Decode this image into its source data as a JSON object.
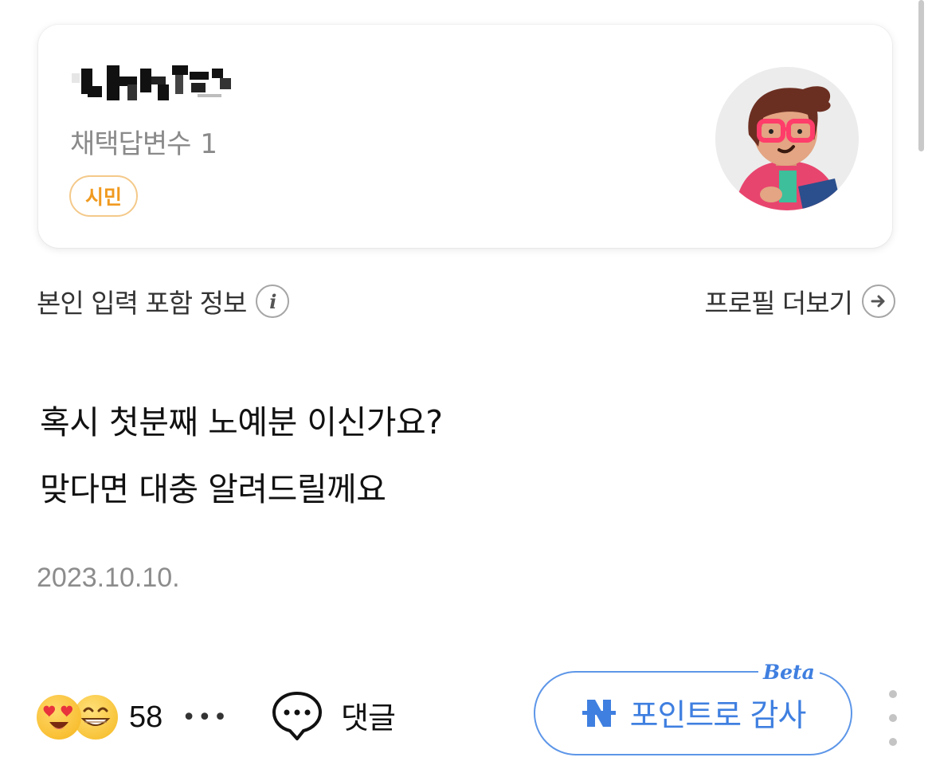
{
  "profile": {
    "answer_count_label": "채택답변수",
    "answer_count": "1",
    "grade": "시민"
  },
  "info": {
    "left_label": "본인 입력 포함 정보",
    "right_label": "프로필 더보기"
  },
  "answer": {
    "lines": [
      "혹시 첫분째 노예분 이신가요?",
      "맞다면 대충 알려드릴께요"
    ],
    "date": "2023.10.10."
  },
  "actions": {
    "reaction_count": "58",
    "more_reactions": "•••",
    "comment_label": "댓글",
    "thanks_label": "포인트로 감사",
    "beta_tag": "Beta"
  },
  "icons": {
    "info": "info-icon",
    "profile_more": "arrow-right-circle-icon",
    "comment": "speech-bubble-icon",
    "naver_pay": "naver-n-icon",
    "reaction_1": "heart-eyes-emoji",
    "reaction_2": "grinning-emoji",
    "menu": "vertical-dots-icon"
  },
  "colors": {
    "grade_badge": "#f09a20",
    "thanks_accent": "#3f7fe0",
    "muted_text": "#8a8a8a"
  }
}
